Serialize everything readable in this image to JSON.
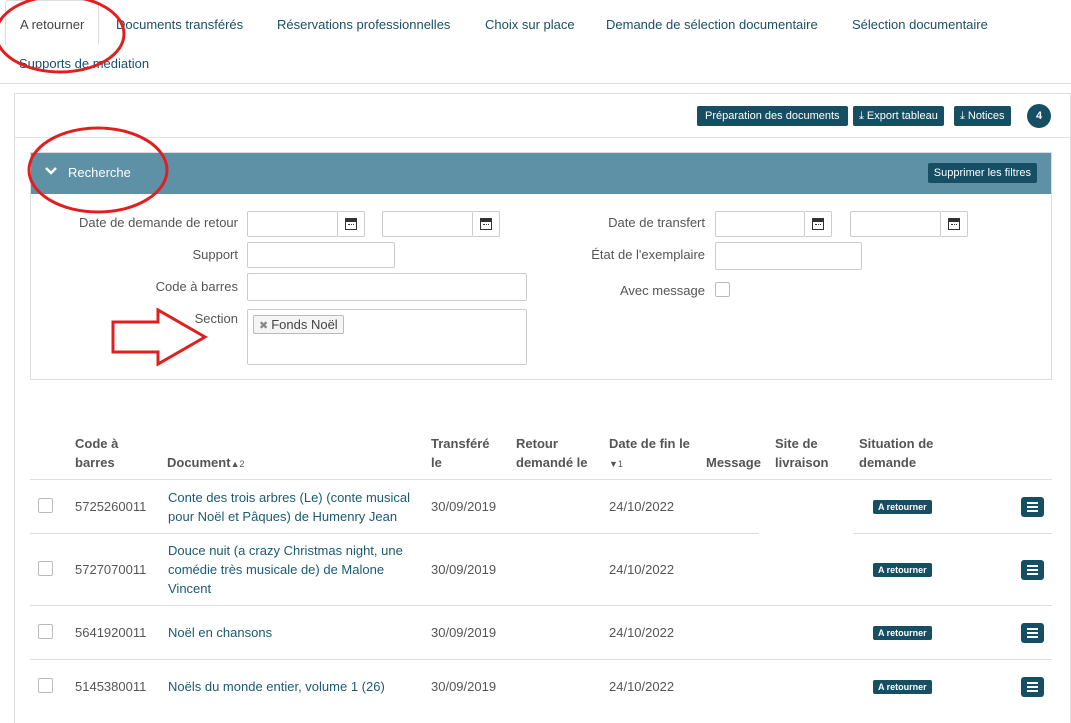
{
  "tabs": [
    {
      "label": "A retourner"
    },
    {
      "label": "Documents transférés"
    },
    {
      "label": "Réservations professionnelles"
    },
    {
      "label": "Choix sur place"
    },
    {
      "label": "Demande de sélection documentaire"
    },
    {
      "label": "Sélection documentaire"
    },
    {
      "label": "Supports de médiation"
    }
  ],
  "toolbar": {
    "prep_label": "Préparation des documents",
    "export_label": "Export tableau",
    "notices_label": "Notices",
    "count": "4"
  },
  "search": {
    "title": "Recherche",
    "clear_label": "Supprimer les filtres",
    "fields": {
      "date_demande_retour": "Date de demande de retour",
      "support": "Support",
      "code_barres": "Code à barres",
      "section": "Section",
      "date_transfert": "Date de transfert",
      "etat_exemplaire": "État de l'exemplaire",
      "avec_message": "Avec message"
    },
    "section_chip": "Fonds Noël"
  },
  "table": {
    "headers": {
      "code_l1": "Code à",
      "code_l2": "barres",
      "document": "Document",
      "document_sort": "2",
      "transfere_l1": "Transféré",
      "transfere_l2": "le",
      "retour_l1": "Retour",
      "retour_l2": "demandé le",
      "datefin_l1": "Date de fin le",
      "datefin_sort": "1",
      "message": "Message",
      "site_l1": "Site de",
      "site_l2": "livraison",
      "situation_l1": "Situation de",
      "situation_l2": "demande"
    },
    "rows": [
      {
        "code": "5725260011",
        "doc_l1": "Conte des trois arbres (Le) (conte musical",
        "doc_l2": "pour Noël et Pâques) de Humenry Jean",
        "doc_l3": "",
        "transfere": "30/09/2019",
        "date_fin": "24/10/2022",
        "status": "A retourner"
      },
      {
        "code": "5727070011",
        "doc_l1": "Douce nuit (a crazy Christmas night, une",
        "doc_l2": "comédie très musicale de) de Malone",
        "doc_l3": "Vincent",
        "transfere": "30/09/2019",
        "date_fin": "24/10/2022",
        "status": "A retourner"
      },
      {
        "code": "5641920011",
        "doc_l1": "Noël en chansons",
        "doc_l2": "",
        "doc_l3": "",
        "transfere": "30/09/2019",
        "date_fin": "24/10/2022",
        "status": "A retourner"
      },
      {
        "code": "5145380011",
        "doc_l1": "Noëls du monde entier, volume 1 (26)",
        "doc_l2": "",
        "doc_l3": "",
        "transfere": "30/09/2019",
        "date_fin": "24/10/2022",
        "status": "A retourner"
      }
    ]
  },
  "colors": {
    "primary": "#164f63",
    "header_bar": "#5e91a6",
    "link": "#1a5a72",
    "annotation": "#e02020"
  }
}
